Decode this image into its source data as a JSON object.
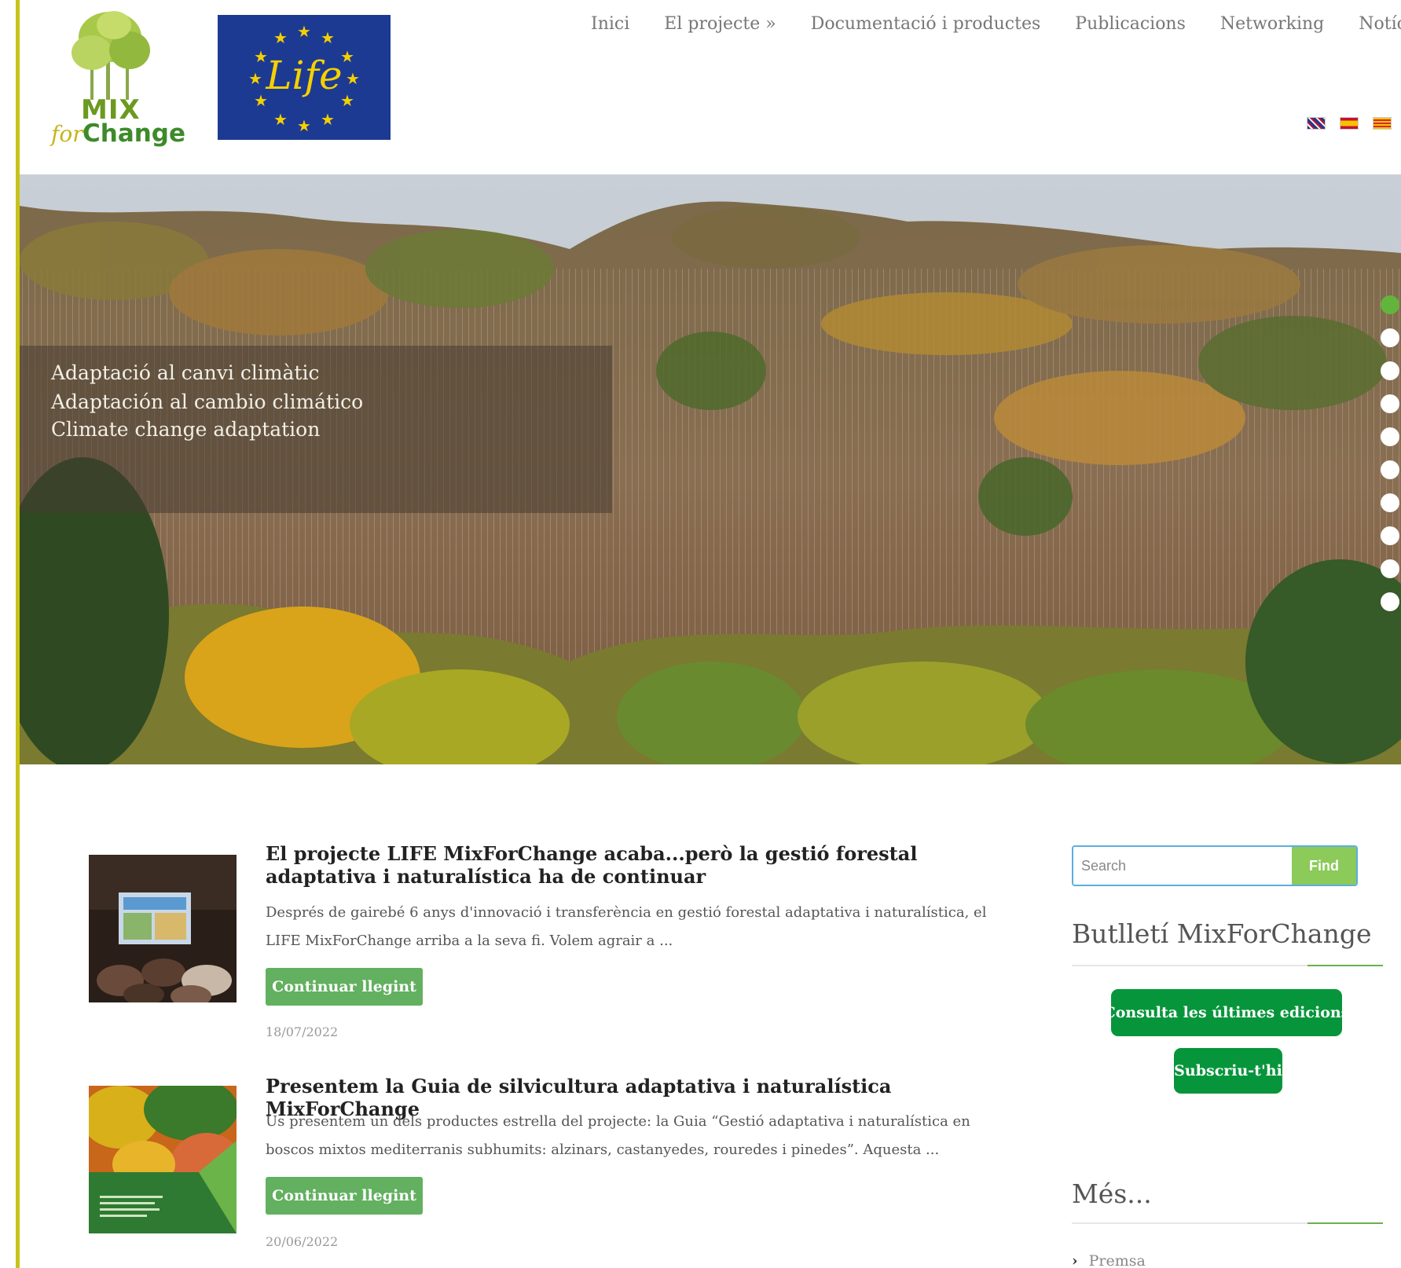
{
  "brand": {
    "logo_mix": "MIX",
    "logo_for": "for",
    "logo_change": "Change",
    "life_text": "Life"
  },
  "nav": {
    "items": [
      {
        "label": "Inici"
      },
      {
        "label": "El projecte »"
      },
      {
        "label": "Documentació i productes"
      },
      {
        "label": "Publicacions"
      },
      {
        "label": "Networking"
      },
      {
        "label": "Notícies"
      }
    ]
  },
  "languages": [
    "en-flag-icon",
    "es-flag-icon",
    "ca-flag-icon"
  ],
  "hero": {
    "lines": [
      "Adaptació al canvi climàtic",
      "Adaptación al cambio climático",
      "Climate change adaptation"
    ],
    "slide_count": 10,
    "active_slide": 1
  },
  "posts": [
    {
      "title": "El projecte LIFE MixForChange acaba...però la gestió forestal adaptativa i naturalística ha de continuar",
      "excerpt": "Després de gairebé 6 anys d'innovació i transferència en gestió forestal adaptativa i naturalística, el LIFE MixForChange arriba a la seva fi. Volem agrair a ...",
      "button": "Continuar llegint",
      "date": "18/07/2022"
    },
    {
      "title": "Presentem la Guia de silvicultura adaptativa i naturalística MixForChange",
      "excerpt": "Us presentem un dels productes estrella del projecte: la Guia “Gestió adaptativa i naturalística en boscos mixtos mediterranis subhumits: alzinars, castanyedes, rouredes i pinedes”. Aquesta ...",
      "button": "Continuar llegint",
      "date": "20/06/2022"
    }
  ],
  "sidebar": {
    "search_placeholder": "Search",
    "search_button": "Find",
    "newsletter_heading": "Butlletí MixForChange",
    "newsletter_latest_button": "Consulta les últimes edicions",
    "newsletter_subscribe_button": "Subscriu-t'hi",
    "more_heading": "Més...",
    "more_items": [
      "Premsa"
    ]
  },
  "colors": {
    "accent_green": "#62b060",
    "dark_green": "#07953c",
    "left_rule": "#c8c21a",
    "life_blue": "#1d3a92"
  }
}
